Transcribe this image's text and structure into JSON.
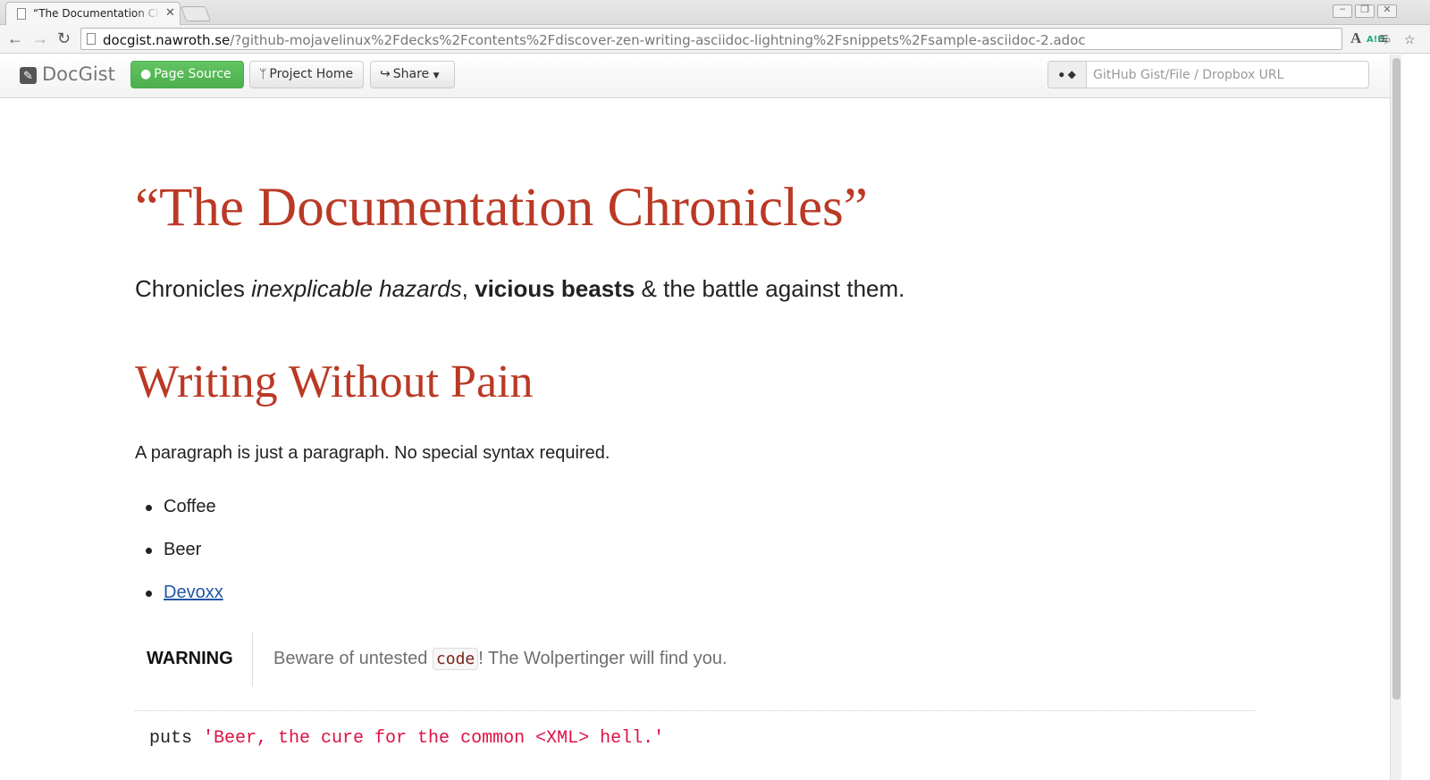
{
  "browser": {
    "tab_title": "“The Documentation Chronicles”",
    "url_host": "docgist.nawroth.se",
    "url_path": "/?github-mojavelinux%2Fdecks%2Fcontents%2Fdiscover-zen-writing-asciidoc-lightning%2Fsnippets%2Fsample-asciidoc-2.adoc",
    "abp_label": "A!D"
  },
  "appbar": {
    "brand": "DocGist",
    "page_source": "Page Source",
    "project_home": "Project Home",
    "share": "Share",
    "search_placeholder": "GitHub Gist/File / Dropbox URL"
  },
  "doc": {
    "title": "“The Documentation Chronicles”",
    "lead": {
      "prefix": "Chronicles ",
      "em": "inexplicable hazards",
      "sep": ", ",
      "strong": "vicious beasts",
      "suffix": " & the battle against them."
    },
    "section_title": "Writing Without Pain",
    "paragraph": "A paragraph is just a paragraph. No special syntax required.",
    "list": [
      "Coffee",
      "Beer",
      "Devoxx"
    ],
    "admonition": {
      "label": "WARNING",
      "before": "Beware of untested ",
      "code": "code",
      "after": "! The Wolpertinger will find you."
    },
    "code": {
      "keyword": "puts ",
      "string": "'Beer, the cure for the common <XML> hell.'"
    }
  },
  "colors": {
    "heading": "#ba3925",
    "link": "#2156a5",
    "success": "#5cb85c",
    "code_string": "#d14"
  }
}
